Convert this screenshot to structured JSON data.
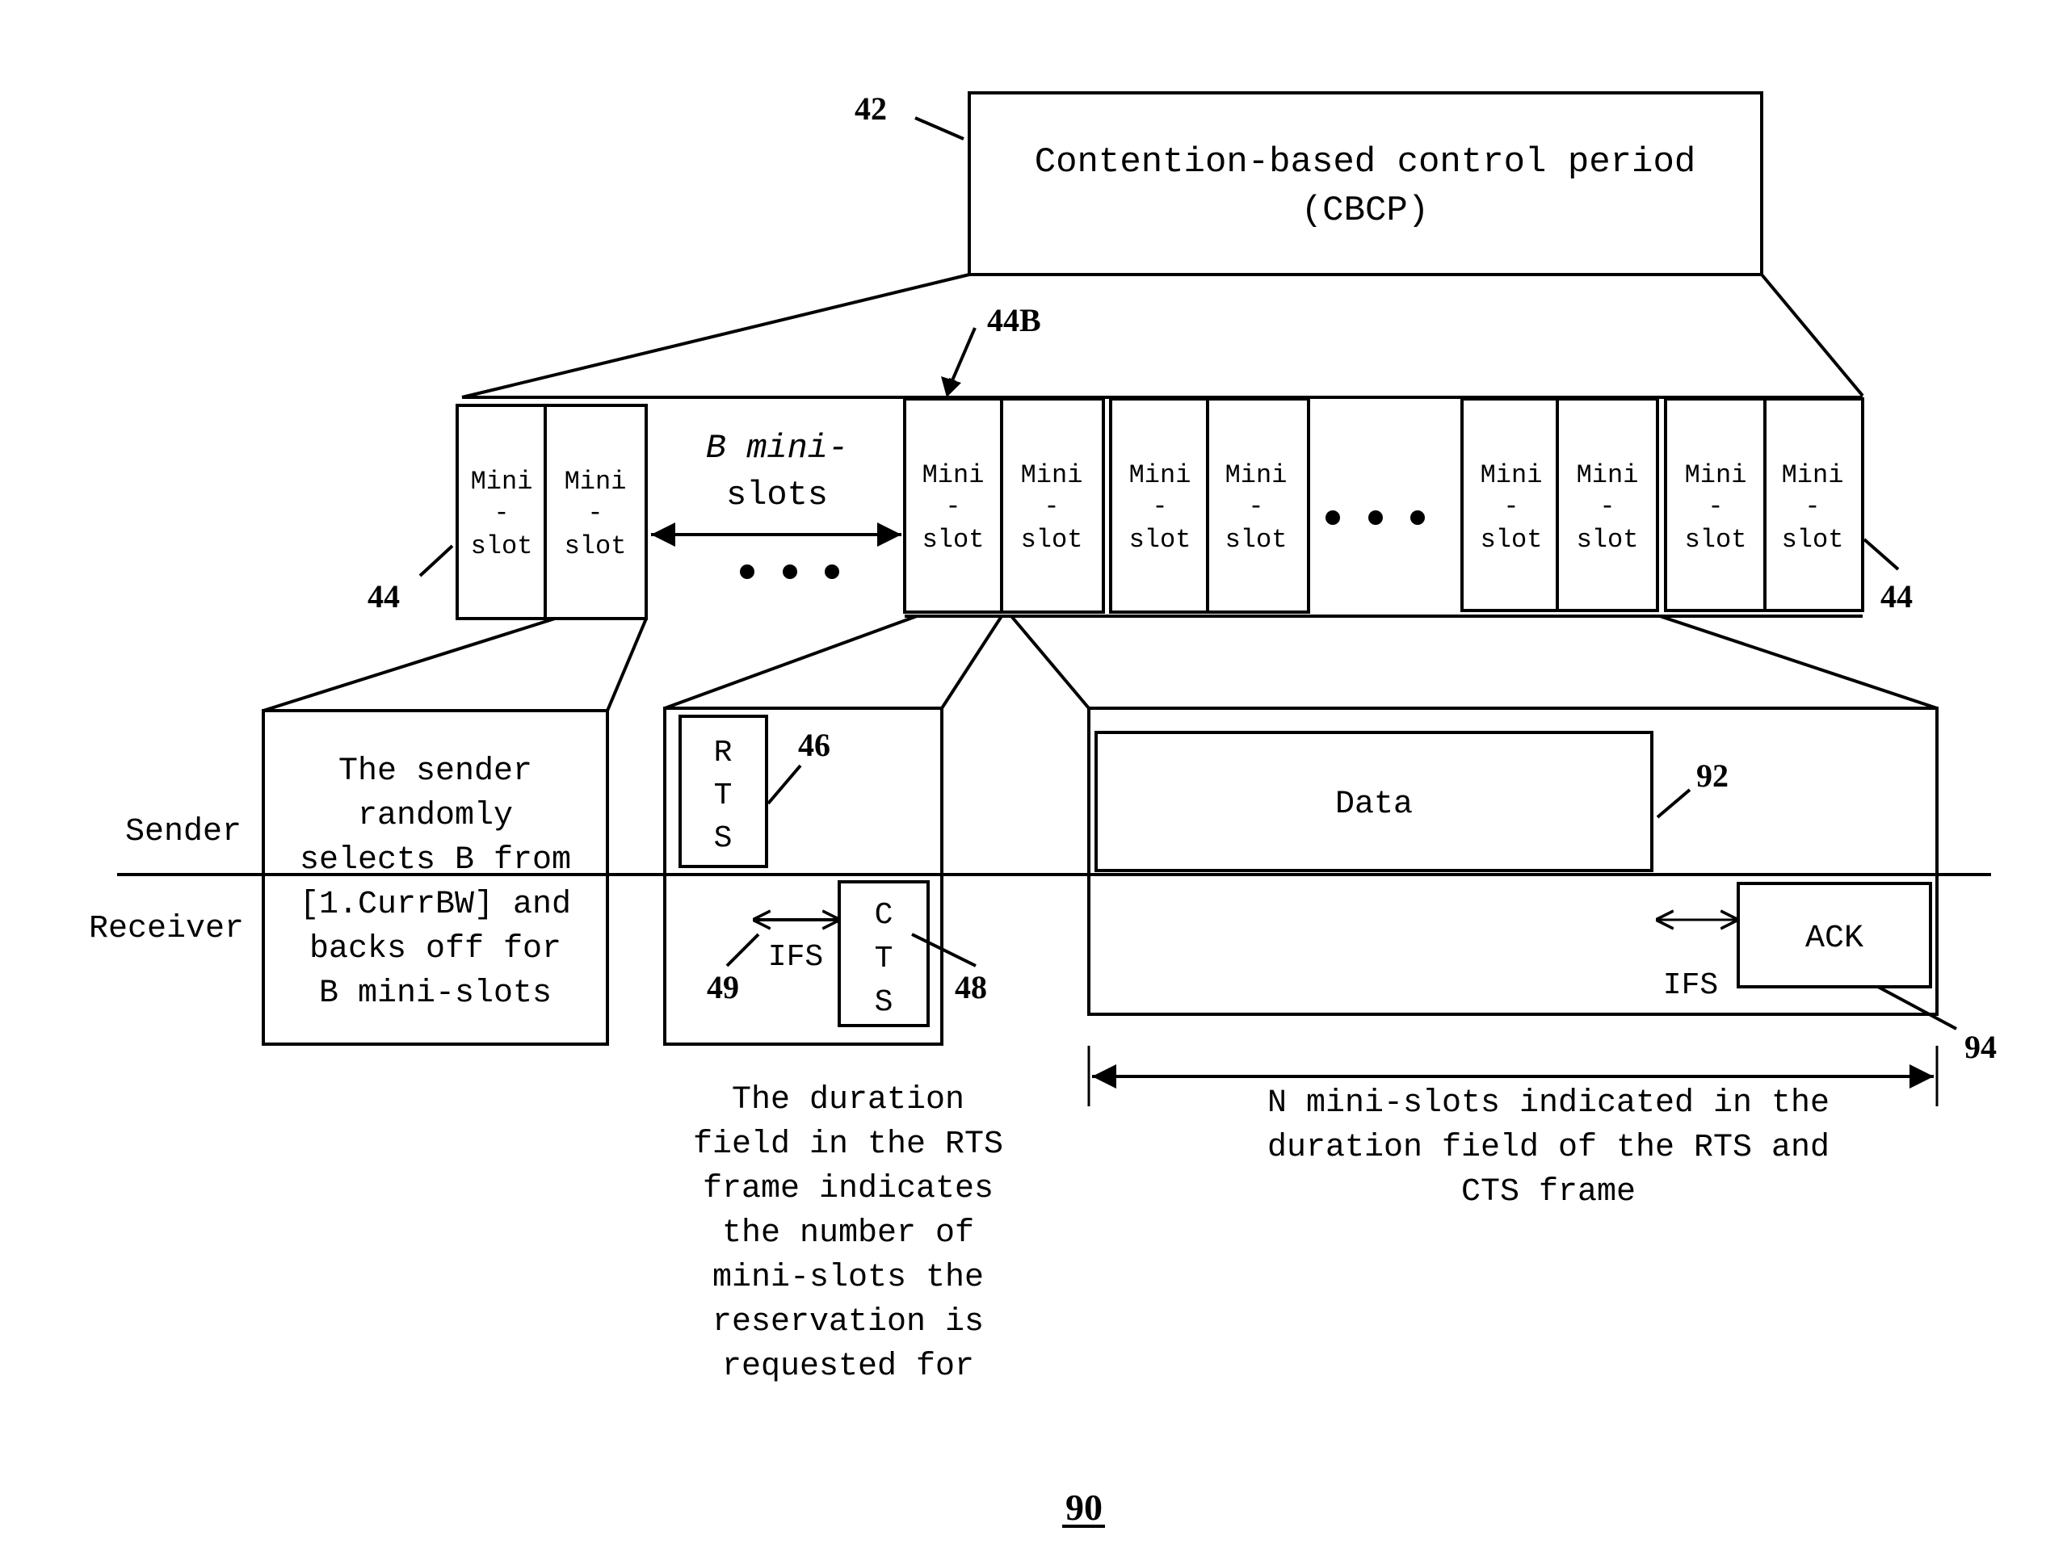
{
  "figure": {
    "number": "90",
    "colors": {
      "stroke": "#000000",
      "background": "#ffffff"
    }
  },
  "cbcp": {
    "ref": "42",
    "title_line1": "Contention-based control period",
    "title_line2": "(CBCP)"
  },
  "miniSlotRow": {
    "ref_left": "44",
    "ref_right": "44",
    "ref_pointer": "44B",
    "slot_text": {
      "line1": "Mini",
      "line2": "-",
      "line3": "slot"
    },
    "groups": [
      {
        "slots": 2
      },
      {
        "slots": 2
      },
      {
        "slots": 2
      },
      {
        "slots": 2
      },
      {
        "slots": 2
      }
    ],
    "backoff_label_line1": "B mini-",
    "backoff_label_line2": "slots",
    "ellipsis": "• • •"
  },
  "lanes": {
    "sender": "Sender",
    "receiver": "Receiver"
  },
  "backoffBox": {
    "lines": [
      "The sender",
      "randomly",
      "selects B from",
      "[1.CurrBW] and",
      "backs off for",
      "B mini-slots"
    ]
  },
  "rtsCts": {
    "rts_letters": [
      "R",
      "T",
      "S"
    ],
    "cts_letters": [
      "C",
      "T",
      "S"
    ],
    "rts_ref": "46",
    "cts_ref": "48",
    "ifs_ref": "49",
    "ifs_label": "IFS",
    "caption": [
      "The duration",
      "field in the RTS",
      "frame indicates",
      "the number of",
      "mini-slots the",
      "reservation is",
      "requested for"
    ]
  },
  "dataAck": {
    "data_label": "Data",
    "data_ref": "92",
    "ack_label": "ACK",
    "ack_ref": "94",
    "ifs_label": "IFS",
    "caption": [
      "N mini-slots indicated in the",
      "duration field of the RTS and",
      "CTS frame"
    ]
  }
}
